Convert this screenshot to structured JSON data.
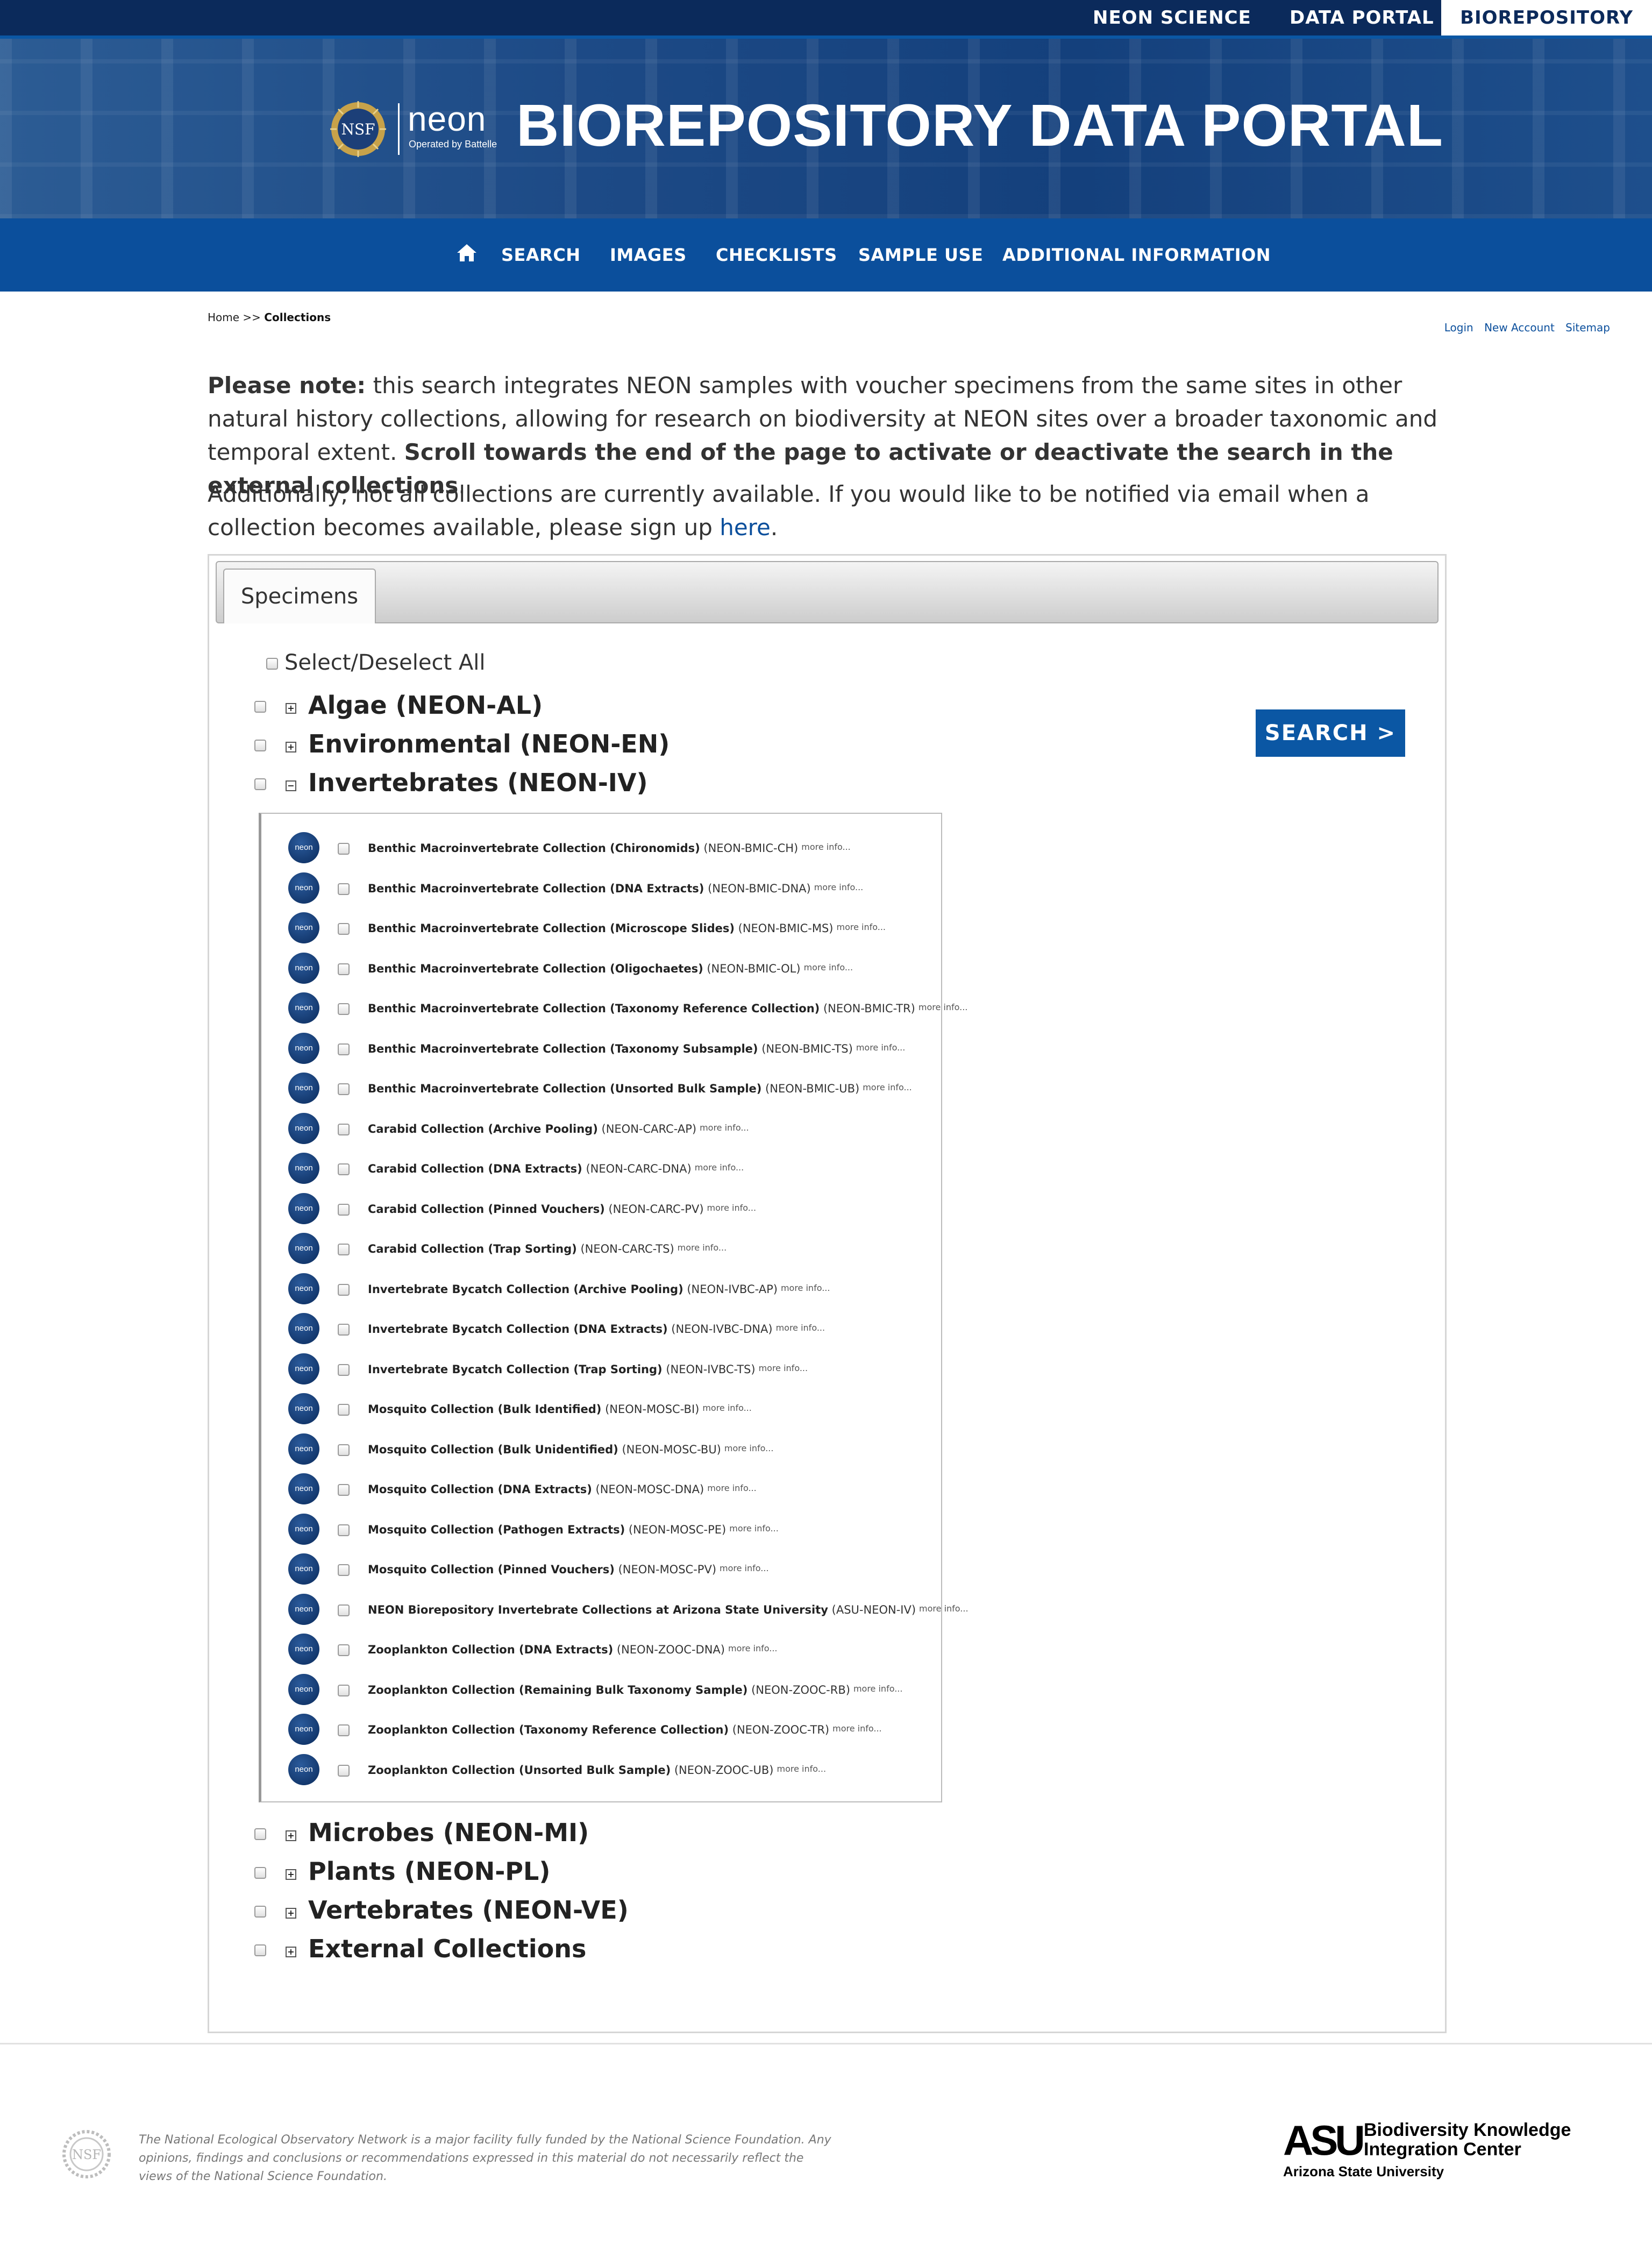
{
  "top_links": [
    "NEON SCIENCE",
    "DATA PORTAL",
    "BIOREPOSITORY"
  ],
  "banner": {
    "title": "BIOREPOSITORY DATA PORTAL",
    "neon_wordmark": "neon",
    "neon_tagline": "Operated by Battelle",
    "nsf_seal_text": "NSF"
  },
  "nav": {
    "items": [
      "SEARCH",
      "IMAGES",
      "CHECKLISTS",
      "SAMPLE USE",
      "ADDITIONAL INFORMATION"
    ]
  },
  "breadcrumb": {
    "home": "Home",
    "sep": ">>",
    "current": "Collections"
  },
  "account_links": [
    "Login",
    "New Account",
    "Sitemap"
  ],
  "notes": {
    "p1_bold_lead": "Please note:",
    "p1_text": " this search integrates NEON samples with voucher specimens from the same sites in other natural history collections, allowing for research on biodiversity at NEON sites over a broader taxonomic and temporal extent. ",
    "p1_bold_tail": "Scroll towards the end of the page to activate or deactivate the search in the external collections",
    "p1_end": ".",
    "p2_text": "Additionally, not all collections are currently available. If you would like to be notified via email when a collection becomes available, please sign up ",
    "p2_link": "here",
    "p2_end": "."
  },
  "panel": {
    "tab": "Specimens",
    "select_all": "Select/Deselect All",
    "search_button": "SEARCH >",
    "expand_symbol": "+",
    "collapse_symbol": "−",
    "categories": [
      "Algae (NEON-AL)",
      "Environmental (NEON-EN)",
      "Invertebrates (NEON-IV)",
      "Microbes (NEON-MI)",
      "Plants (NEON-PL)",
      "Vertebrates (NEON-VE)",
      "External Collections"
    ],
    "collection_logo_text": "neon",
    "more_info": "more info...",
    "collections": [
      {
        "name": "Benthic Macroinvertebrate Collection (Chironomids)",
        "code": "(NEON-BMIC-CH)"
      },
      {
        "name": "Benthic Macroinvertebrate Collection (DNA Extracts)",
        "code": "(NEON-BMIC-DNA)"
      },
      {
        "name": "Benthic Macroinvertebrate Collection (Microscope Slides)",
        "code": "(NEON-BMIC-MS)"
      },
      {
        "name": "Benthic Macroinvertebrate Collection (Oligochaetes)",
        "code": "(NEON-BMIC-OL)"
      },
      {
        "name": "Benthic Macroinvertebrate Collection (Taxonomy Reference Collection)",
        "code": "(NEON-BMIC-TR)"
      },
      {
        "name": "Benthic Macroinvertebrate Collection (Taxonomy Subsample)",
        "code": "(NEON-BMIC-TS)"
      },
      {
        "name": "Benthic Macroinvertebrate Collection (Unsorted Bulk Sample)",
        "code": "(NEON-BMIC-UB)"
      },
      {
        "name": "Carabid Collection (Archive Pooling)",
        "code": "(NEON-CARC-AP)"
      },
      {
        "name": "Carabid Collection (DNA Extracts)",
        "code": "(NEON-CARC-DNA)"
      },
      {
        "name": "Carabid Collection (Pinned Vouchers)",
        "code": "(NEON-CARC-PV)"
      },
      {
        "name": "Carabid Collection (Trap Sorting)",
        "code": "(NEON-CARC-TS)"
      },
      {
        "name": "Invertebrate Bycatch Collection (Archive Pooling)",
        "code": "(NEON-IVBC-AP)"
      },
      {
        "name": "Invertebrate Bycatch Collection (DNA Extracts)",
        "code": "(NEON-IVBC-DNA)"
      },
      {
        "name": "Invertebrate Bycatch Collection (Trap Sorting)",
        "code": "(NEON-IVBC-TS)"
      },
      {
        "name": "Mosquito Collection (Bulk Identified)",
        "code": "(NEON-MOSC-BI)"
      },
      {
        "name": "Mosquito Collection (Bulk Unidentified)",
        "code": "(NEON-MOSC-BU)"
      },
      {
        "name": "Mosquito Collection (DNA Extracts)",
        "code": "(NEON-MOSC-DNA)"
      },
      {
        "name": "Mosquito Collection (Pathogen Extracts)",
        "code": "(NEON-MOSC-PE)"
      },
      {
        "name": "Mosquito Collection (Pinned Vouchers)",
        "code": "(NEON-MOSC-PV)"
      },
      {
        "name": "NEON Biorepository Invertebrate Collections at Arizona State University",
        "code": "(ASU-NEON-IV)"
      },
      {
        "name": "Zooplankton Collection (DNA Extracts)",
        "code": "(NEON-ZOOC-DNA)"
      },
      {
        "name": "Zooplankton Collection (Remaining Bulk Taxonomy Sample)",
        "code": "(NEON-ZOOC-RB)"
      },
      {
        "name": "Zooplankton Collection (Taxonomy Reference Collection)",
        "code": "(NEON-ZOOC-TR)"
      },
      {
        "name": "Zooplankton Collection (Unsorted Bulk Sample)",
        "code": "(NEON-ZOOC-UB)"
      }
    ]
  },
  "footer": {
    "disclaimer": "The National Ecological Observatory Network is a major facility fully funded by the National Science Foundation. Any opinions, findings and conclusions or recommendations expressed in this material do not necessarily reflect the views of the National Science Foundation.",
    "asu_mark": "ASU",
    "asu_center_line1": "Biodiversity Knowledge",
    "asu_center_line2": "Integration Center",
    "asu_university": "Arizona State University"
  },
  "colors": {
    "topbar": "#0b2a5b",
    "nav": "#0b4f9c",
    "button": "#0b57a4",
    "link": "#0b4f9c"
  }
}
